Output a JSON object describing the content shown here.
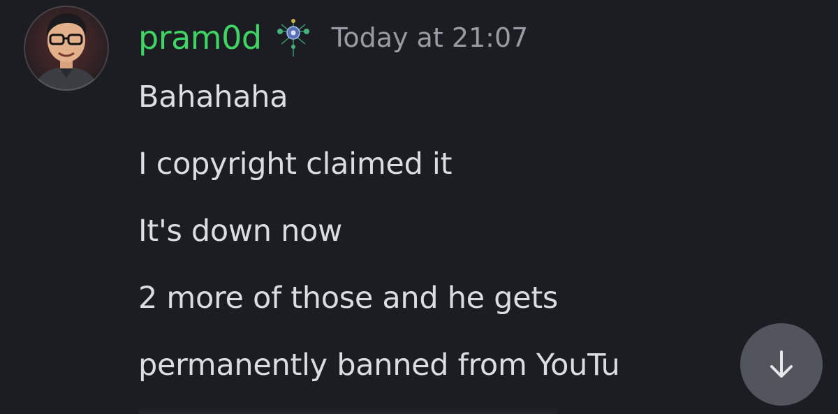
{
  "message": {
    "author": {
      "username": "pram0d",
      "avatar_icon": "user-avatar",
      "badge_icon": "server-badge-icon",
      "name_color": "#3fd463"
    },
    "timestamp": "Today at 21:07",
    "lines": [
      "Bahahaha",
      "I copyright claimed it",
      "It's down now",
      "2 more of those and he gets",
      "permanently banned from YouTu"
    ]
  },
  "controls": {
    "scroll_down_icon": "arrow-down-icon"
  },
  "colors": {
    "background": "#1c1d22",
    "text": "#dcdde2",
    "muted": "#9a9ca3",
    "scroll_button": "#53555c"
  }
}
